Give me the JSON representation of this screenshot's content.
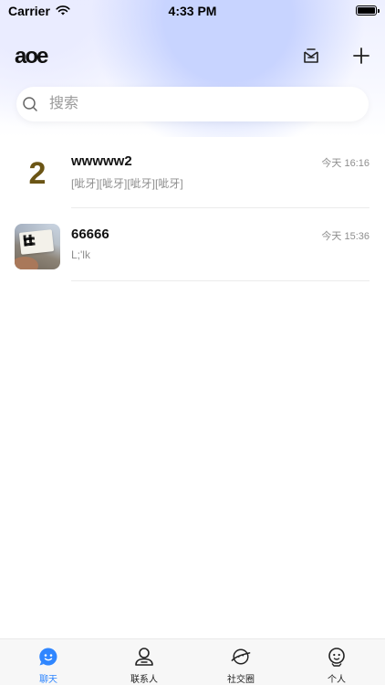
{
  "status_bar": {
    "carrier": "Carrier",
    "time": "4:33 PM"
  },
  "header": {
    "logo_text": "aoe"
  },
  "search": {
    "placeholder": "搜索"
  },
  "chats": [
    {
      "avatar_text": "2",
      "name": "wwwww2",
      "time": "今天 16:16",
      "preview": "[呲牙][呲牙][呲牙][呲牙]"
    },
    {
      "avatar_text": "",
      "name": "66666",
      "time": "今天 15:36",
      "preview": "L;'lk"
    }
  ],
  "tabbar": {
    "tabs": [
      {
        "label": "聊天",
        "icon": "chat-face-icon",
        "active": true
      },
      {
        "label": "联系人",
        "icon": "contact-person-icon",
        "active": false
      },
      {
        "label": "社交圈",
        "icon": "planet-icon",
        "active": false
      },
      {
        "label": "个人",
        "icon": "profile-face-icon",
        "active": false
      }
    ]
  },
  "colors": {
    "accent": "#2f86ff",
    "text_secondary": "#8e8e8e"
  }
}
